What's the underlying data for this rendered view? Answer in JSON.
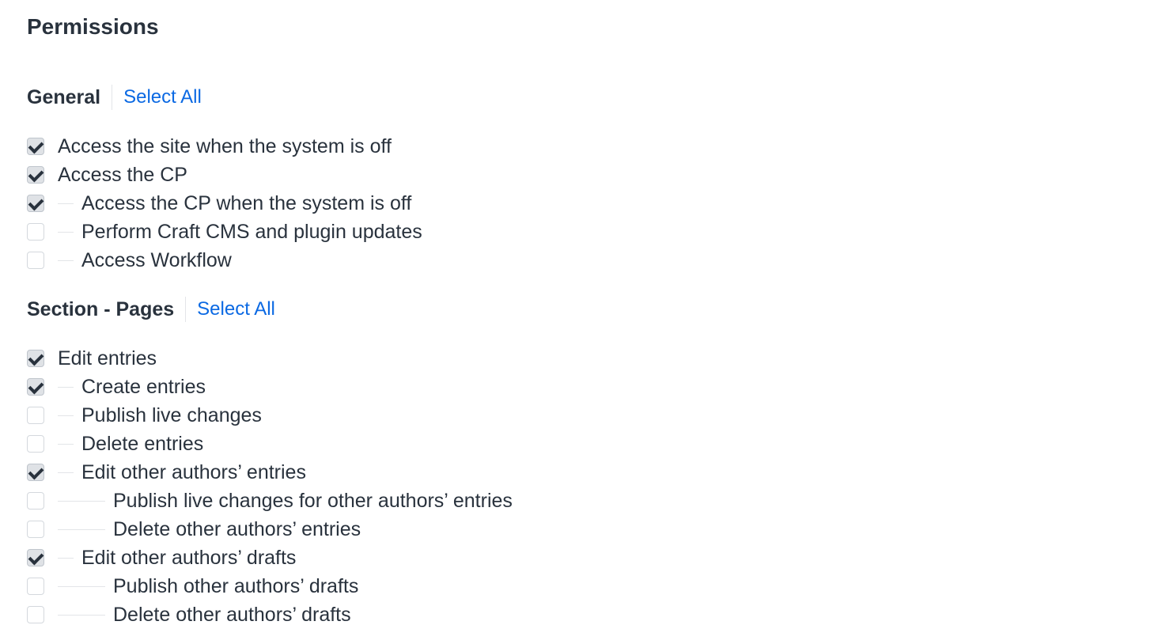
{
  "title": "Permissions",
  "groups": [
    {
      "heading": "General",
      "select_all": "Select All",
      "items": [
        {
          "label": "Access the site when the system is off",
          "checked": true,
          "level": 0
        },
        {
          "label": "Access the CP",
          "checked": true,
          "level": 0
        },
        {
          "label": "Access the CP when the system is off",
          "checked": true,
          "level": 1
        },
        {
          "label": "Perform Craft CMS and plugin updates",
          "checked": false,
          "level": 1
        },
        {
          "label": "Access Workflow",
          "checked": false,
          "level": 1
        }
      ]
    },
    {
      "heading": "Section - Pages",
      "select_all": "Select All",
      "items": [
        {
          "label": "Edit entries",
          "checked": true,
          "level": 0
        },
        {
          "label": "Create entries",
          "checked": true,
          "level": 1
        },
        {
          "label": "Publish live changes",
          "checked": false,
          "level": 1
        },
        {
          "label": "Delete entries",
          "checked": false,
          "level": 1
        },
        {
          "label": "Edit other authors’ entries",
          "checked": true,
          "level": 1
        },
        {
          "label": "Publish live changes for other authors’ entries",
          "checked": false,
          "level": 2
        },
        {
          "label": "Delete other authors’ entries",
          "checked": false,
          "level": 2
        },
        {
          "label": "Edit other authors’ drafts",
          "checked": true,
          "level": 1
        },
        {
          "label": "Publish other authors’ drafts",
          "checked": false,
          "level": 2
        },
        {
          "label": "Delete other authors’ drafts",
          "checked": false,
          "level": 2
        }
      ]
    }
  ],
  "colors": {
    "link": "#0b69e3",
    "text": "#29323d"
  }
}
